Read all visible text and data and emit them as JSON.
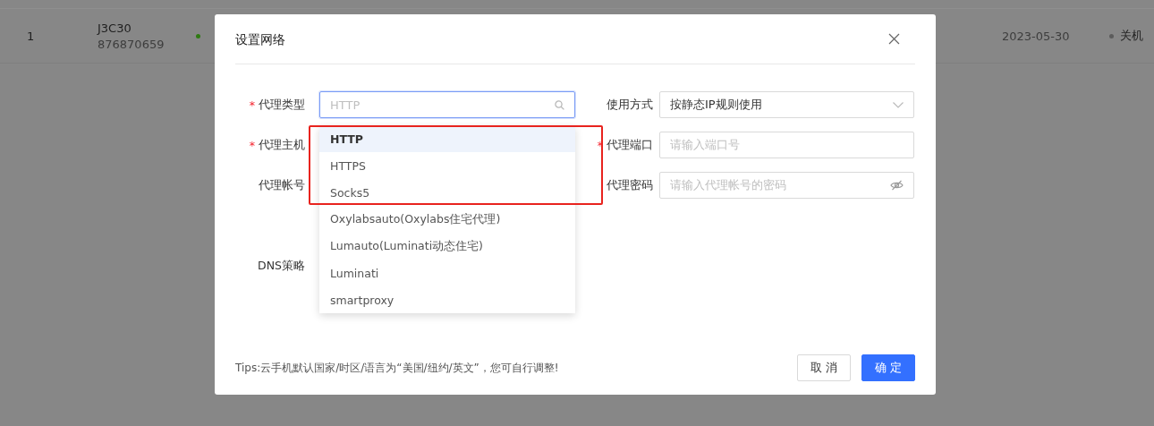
{
  "background_table": {
    "rows": [
      {
        "index": "1",
        "name": "J3C30",
        "id": "876870659",
        "status": {
          "color": "#2e7a12"
        },
        "date": "2023-05-30",
        "power": {
          "label": "关机",
          "color": "#5c5c5c"
        }
      }
    ]
  },
  "dialog": {
    "title": "设置网络",
    "rows": [
      [
        {
          "label": "代理类型",
          "mark": "*",
          "kind": "search",
          "placeholder": "HTTP"
        },
        {
          "label": "使用方式",
          "kind": "select",
          "value": "按静态IP规则使用"
        }
      ],
      [
        {
          "label": "代理主机",
          "mark": "*",
          "kind": "covered"
        },
        {
          "label": "代理端口",
          "mark": "*",
          "kind": "text",
          "placeholder": "请输入端口号"
        }
      ],
      [
        {
          "label": "代理帐号",
          "kind": "covered"
        },
        {
          "label": "代理密码",
          "kind": "password",
          "placeholder": "请输入代理帐号的密码"
        }
      ],
      [],
      [
        {
          "label": "DNS策略",
          "kind": "covered"
        }
      ]
    ],
    "dropdown": {
      "options": [
        {
          "label": "HTTP",
          "selected": true
        },
        {
          "label": "HTTPS",
          "selected": false
        },
        {
          "label": "Socks5",
          "selected": false
        },
        {
          "label": "Oxylabsauto(Oxylabs住宅代理)",
          "selected": false
        },
        {
          "label": "Lumauto(Luminati动态住宅)",
          "selected": false
        },
        {
          "label": "Luminati",
          "selected": false
        },
        {
          "label": "smartproxy",
          "selected": false
        }
      ]
    },
    "tips": "Tips:云手机默认国家/时区/语言为“美国/纽约/英文”，您可自行调整!",
    "buttons": [
      {
        "label": "取 消",
        "kind": "secondary"
      },
      {
        "label": "确 定",
        "kind": "primary"
      }
    ]
  }
}
